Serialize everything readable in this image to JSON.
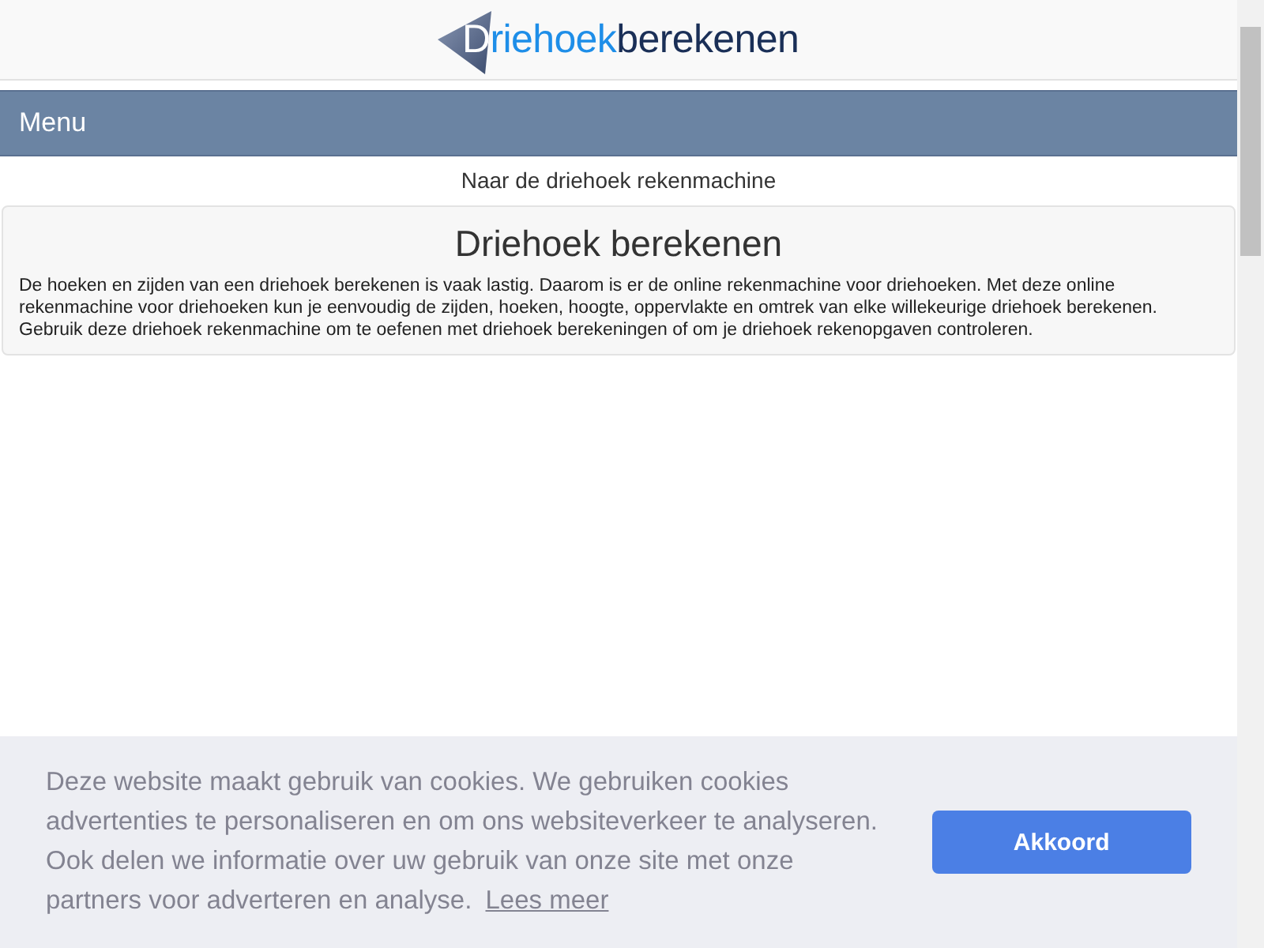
{
  "logo": {
    "parts": [
      "Driehoek",
      "berekenen"
    ]
  },
  "menu": {
    "label": "Menu"
  },
  "calculator_link": "Naar de driehoek rekenmachine",
  "intro": {
    "title": "Driehoek berekenen",
    "text": "De hoeken en zijden van een driehoek berekenen is vaak lastig. Daarom is er de online rekenmachine voor driehoeken. Met deze online rekenmachine voor driehoeken kun je eenvoudig de zijden, hoeken, hoogte, oppervlakte en omtrek van elke willekeurige driehoek berekenen. Gebruik deze driehoek rekenmachine om te oefenen met driehoek berekeningen of om je driehoek rekenopgaven controleren."
  },
  "cookie_banner": {
    "message": "Deze website maakt gebruik van cookies. We gebruiken cookies advertenties te personaliseren en om ons websiteverkeer te analyseren. Ook delen we informatie over uw gebruik van onze site met onze partners voor adverteren en analyse.",
    "link": "Lees meer",
    "button": "Akkoord"
  }
}
